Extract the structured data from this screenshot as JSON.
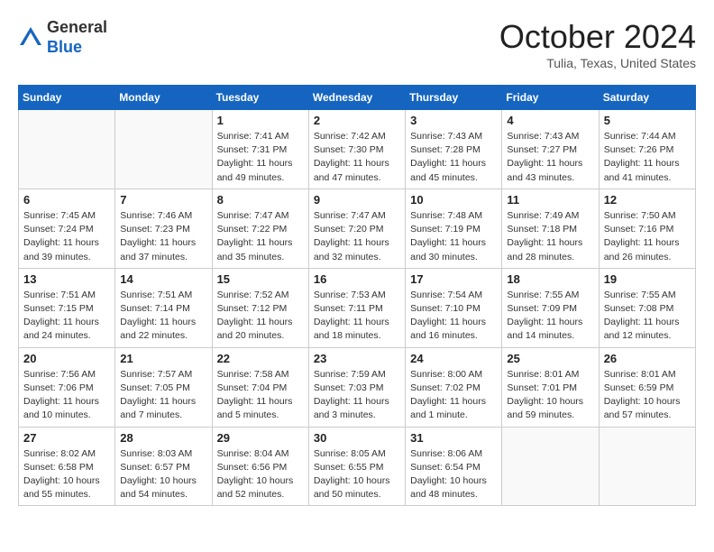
{
  "header": {
    "logo_general": "General",
    "logo_blue": "Blue",
    "month_title": "October 2024",
    "location": "Tulia, Texas, United States"
  },
  "days_of_week": [
    "Sunday",
    "Monday",
    "Tuesday",
    "Wednesday",
    "Thursday",
    "Friday",
    "Saturday"
  ],
  "weeks": [
    [
      {
        "day": "",
        "info": ""
      },
      {
        "day": "",
        "info": ""
      },
      {
        "day": "1",
        "sunrise": "Sunrise: 7:41 AM",
        "sunset": "Sunset: 7:31 PM",
        "daylight": "Daylight: 11 hours and 49 minutes."
      },
      {
        "day": "2",
        "sunrise": "Sunrise: 7:42 AM",
        "sunset": "Sunset: 7:30 PM",
        "daylight": "Daylight: 11 hours and 47 minutes."
      },
      {
        "day": "3",
        "sunrise": "Sunrise: 7:43 AM",
        "sunset": "Sunset: 7:28 PM",
        "daylight": "Daylight: 11 hours and 45 minutes."
      },
      {
        "day": "4",
        "sunrise": "Sunrise: 7:43 AM",
        "sunset": "Sunset: 7:27 PM",
        "daylight": "Daylight: 11 hours and 43 minutes."
      },
      {
        "day": "5",
        "sunrise": "Sunrise: 7:44 AM",
        "sunset": "Sunset: 7:26 PM",
        "daylight": "Daylight: 11 hours and 41 minutes."
      }
    ],
    [
      {
        "day": "6",
        "sunrise": "Sunrise: 7:45 AM",
        "sunset": "Sunset: 7:24 PM",
        "daylight": "Daylight: 11 hours and 39 minutes."
      },
      {
        "day": "7",
        "sunrise": "Sunrise: 7:46 AM",
        "sunset": "Sunset: 7:23 PM",
        "daylight": "Daylight: 11 hours and 37 minutes."
      },
      {
        "day": "8",
        "sunrise": "Sunrise: 7:47 AM",
        "sunset": "Sunset: 7:22 PM",
        "daylight": "Daylight: 11 hours and 35 minutes."
      },
      {
        "day": "9",
        "sunrise": "Sunrise: 7:47 AM",
        "sunset": "Sunset: 7:20 PM",
        "daylight": "Daylight: 11 hours and 32 minutes."
      },
      {
        "day": "10",
        "sunrise": "Sunrise: 7:48 AM",
        "sunset": "Sunset: 7:19 PM",
        "daylight": "Daylight: 11 hours and 30 minutes."
      },
      {
        "day": "11",
        "sunrise": "Sunrise: 7:49 AM",
        "sunset": "Sunset: 7:18 PM",
        "daylight": "Daylight: 11 hours and 28 minutes."
      },
      {
        "day": "12",
        "sunrise": "Sunrise: 7:50 AM",
        "sunset": "Sunset: 7:16 PM",
        "daylight": "Daylight: 11 hours and 26 minutes."
      }
    ],
    [
      {
        "day": "13",
        "sunrise": "Sunrise: 7:51 AM",
        "sunset": "Sunset: 7:15 PM",
        "daylight": "Daylight: 11 hours and 24 minutes."
      },
      {
        "day": "14",
        "sunrise": "Sunrise: 7:51 AM",
        "sunset": "Sunset: 7:14 PM",
        "daylight": "Daylight: 11 hours and 22 minutes."
      },
      {
        "day": "15",
        "sunrise": "Sunrise: 7:52 AM",
        "sunset": "Sunset: 7:12 PM",
        "daylight": "Daylight: 11 hours and 20 minutes."
      },
      {
        "day": "16",
        "sunrise": "Sunrise: 7:53 AM",
        "sunset": "Sunset: 7:11 PM",
        "daylight": "Daylight: 11 hours and 18 minutes."
      },
      {
        "day": "17",
        "sunrise": "Sunrise: 7:54 AM",
        "sunset": "Sunset: 7:10 PM",
        "daylight": "Daylight: 11 hours and 16 minutes."
      },
      {
        "day": "18",
        "sunrise": "Sunrise: 7:55 AM",
        "sunset": "Sunset: 7:09 PM",
        "daylight": "Daylight: 11 hours and 14 minutes."
      },
      {
        "day": "19",
        "sunrise": "Sunrise: 7:55 AM",
        "sunset": "Sunset: 7:08 PM",
        "daylight": "Daylight: 11 hours and 12 minutes."
      }
    ],
    [
      {
        "day": "20",
        "sunrise": "Sunrise: 7:56 AM",
        "sunset": "Sunset: 7:06 PM",
        "daylight": "Daylight: 11 hours and 10 minutes."
      },
      {
        "day": "21",
        "sunrise": "Sunrise: 7:57 AM",
        "sunset": "Sunset: 7:05 PM",
        "daylight": "Daylight: 11 hours and 7 minutes."
      },
      {
        "day": "22",
        "sunrise": "Sunrise: 7:58 AM",
        "sunset": "Sunset: 7:04 PM",
        "daylight": "Daylight: 11 hours and 5 minutes."
      },
      {
        "day": "23",
        "sunrise": "Sunrise: 7:59 AM",
        "sunset": "Sunset: 7:03 PM",
        "daylight": "Daylight: 11 hours and 3 minutes."
      },
      {
        "day": "24",
        "sunrise": "Sunrise: 8:00 AM",
        "sunset": "Sunset: 7:02 PM",
        "daylight": "Daylight: 11 hours and 1 minute."
      },
      {
        "day": "25",
        "sunrise": "Sunrise: 8:01 AM",
        "sunset": "Sunset: 7:01 PM",
        "daylight": "Daylight: 10 hours and 59 minutes."
      },
      {
        "day": "26",
        "sunrise": "Sunrise: 8:01 AM",
        "sunset": "Sunset: 6:59 PM",
        "daylight": "Daylight: 10 hours and 57 minutes."
      }
    ],
    [
      {
        "day": "27",
        "sunrise": "Sunrise: 8:02 AM",
        "sunset": "Sunset: 6:58 PM",
        "daylight": "Daylight: 10 hours and 55 minutes."
      },
      {
        "day": "28",
        "sunrise": "Sunrise: 8:03 AM",
        "sunset": "Sunset: 6:57 PM",
        "daylight": "Daylight: 10 hours and 54 minutes."
      },
      {
        "day": "29",
        "sunrise": "Sunrise: 8:04 AM",
        "sunset": "Sunset: 6:56 PM",
        "daylight": "Daylight: 10 hours and 52 minutes."
      },
      {
        "day": "30",
        "sunrise": "Sunrise: 8:05 AM",
        "sunset": "Sunset: 6:55 PM",
        "daylight": "Daylight: 10 hours and 50 minutes."
      },
      {
        "day": "31",
        "sunrise": "Sunrise: 8:06 AM",
        "sunset": "Sunset: 6:54 PM",
        "daylight": "Daylight: 10 hours and 48 minutes."
      },
      {
        "day": "",
        "info": ""
      },
      {
        "day": "",
        "info": ""
      }
    ]
  ]
}
